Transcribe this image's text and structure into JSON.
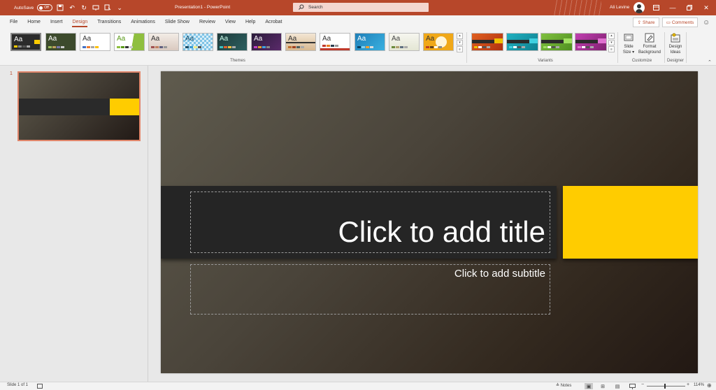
{
  "titlebar": {
    "autosave_label": "AutoSave",
    "autosave_state": "Off",
    "doc_title": "Presentation1 - PowerPoint",
    "search_placeholder": "Search",
    "user_name": "Ali Levine",
    "bg_color": "#b7472a"
  },
  "menu": {
    "tabs": [
      "File",
      "Home",
      "Insert",
      "Design",
      "Transitions",
      "Animations",
      "Slide Show",
      "Review",
      "View",
      "Help",
      "Acrobat"
    ],
    "active_tab": "Design",
    "share_label": "Share",
    "comments_label": "Comments"
  },
  "ribbon": {
    "themes_label": "Themes",
    "variants_label": "Variants",
    "customize_label": "Customize",
    "designer_label": "Designer",
    "theme_glyph": "Aa",
    "slide_size_label": "Slide Size",
    "slide_size_label_1": "Slide",
    "slide_size_label_2": "Size",
    "format_background_1": "Format",
    "format_background_2": "Background",
    "design_ideas_1": "Design",
    "design_ideas_2": "Ideas"
  },
  "thumbnails": [
    {
      "number": "1"
    }
  ],
  "slide": {
    "title_placeholder": "Click to add title",
    "subtitle_placeholder": "Click to add subtitle",
    "accent_color": "#ffcc00",
    "band_color": "#252525"
  },
  "status": {
    "slide_indicator": "Slide 1 of 1",
    "notes_label": "Notes",
    "zoom_level": "114%",
    "zoom_minus": "−",
    "zoom_plus": "+"
  }
}
